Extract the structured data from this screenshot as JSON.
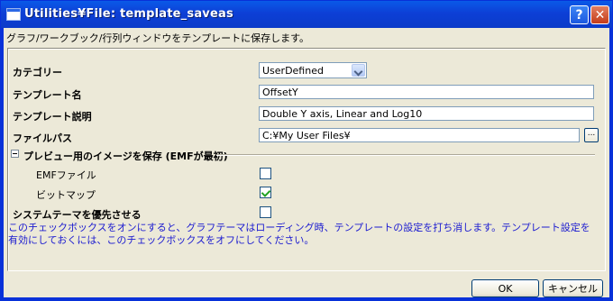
{
  "window": {
    "title": "Utilities¥File: template_saveas",
    "help_glyph": "?",
    "close_glyph": "✕"
  },
  "description": "グラフ/ワークブック/行列ウィンドウをテンプレートに保存します。",
  "form": {
    "category": {
      "label": "カテゴリー",
      "value": "UserDefined"
    },
    "template_name": {
      "label": "テンプレート名",
      "value": "OffsetY"
    },
    "template_desc": {
      "label": "テンプレート説明",
      "value": "Double Y axis, Linear and Log10"
    },
    "file_path": {
      "label": "ファイルパス",
      "value": "C:¥My User Files¥",
      "browse_label": "..."
    },
    "preview_group": {
      "label": "プレビュー用のイメージを保存 (EMFが最初)",
      "emf": {
        "label": "EMFファイル",
        "checked": false
      },
      "bitmap": {
        "label": "ビットマップ",
        "checked": true
      }
    },
    "system_theme": {
      "label": "システムテーマを優先させる",
      "checked": false
    }
  },
  "note": "このチェックボックスをオンにすると、グラフテーマはローディング時、テンプレートの設定を打ち消します。テンプレート設定を有効にしておくには、このチェックボックスをオフにしてください。",
  "buttons": {
    "ok": "OK",
    "cancel": "キャンセル"
  }
}
